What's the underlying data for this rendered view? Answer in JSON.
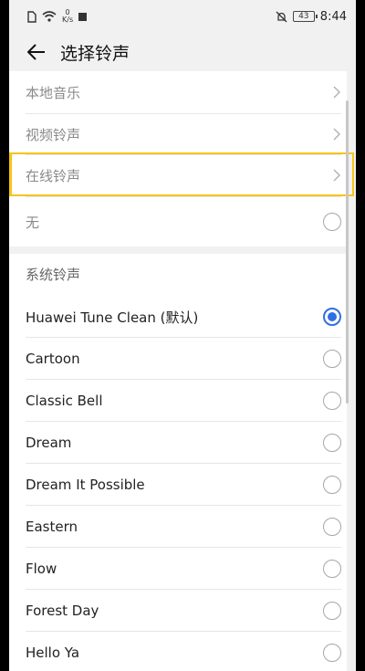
{
  "status_bar": {
    "net_speed_value": "0",
    "net_speed_unit": "K/s",
    "battery": "43",
    "time": "8:44"
  },
  "header": {
    "title": "选择铃声"
  },
  "source_items": [
    {
      "label": "本地音乐"
    },
    {
      "label": "视频铃声"
    },
    {
      "label": "在线铃声"
    },
    {
      "label": "无"
    }
  ],
  "system_section": {
    "title": "系统铃声"
  },
  "ringtones": [
    {
      "label": "Huawei Tune Clean (默认)",
      "selected": true
    },
    {
      "label": "Cartoon",
      "selected": false
    },
    {
      "label": "Classic Bell",
      "selected": false
    },
    {
      "label": "Dream",
      "selected": false
    },
    {
      "label": "Dream It Possible",
      "selected": false
    },
    {
      "label": "Eastern",
      "selected": false
    },
    {
      "label": "Flow",
      "selected": false
    },
    {
      "label": "Forest Day",
      "selected": false
    },
    {
      "label": "Hello Ya",
      "selected": false
    }
  ],
  "colors": {
    "accent": "#2f6fe3",
    "highlight": "#f5c518"
  }
}
